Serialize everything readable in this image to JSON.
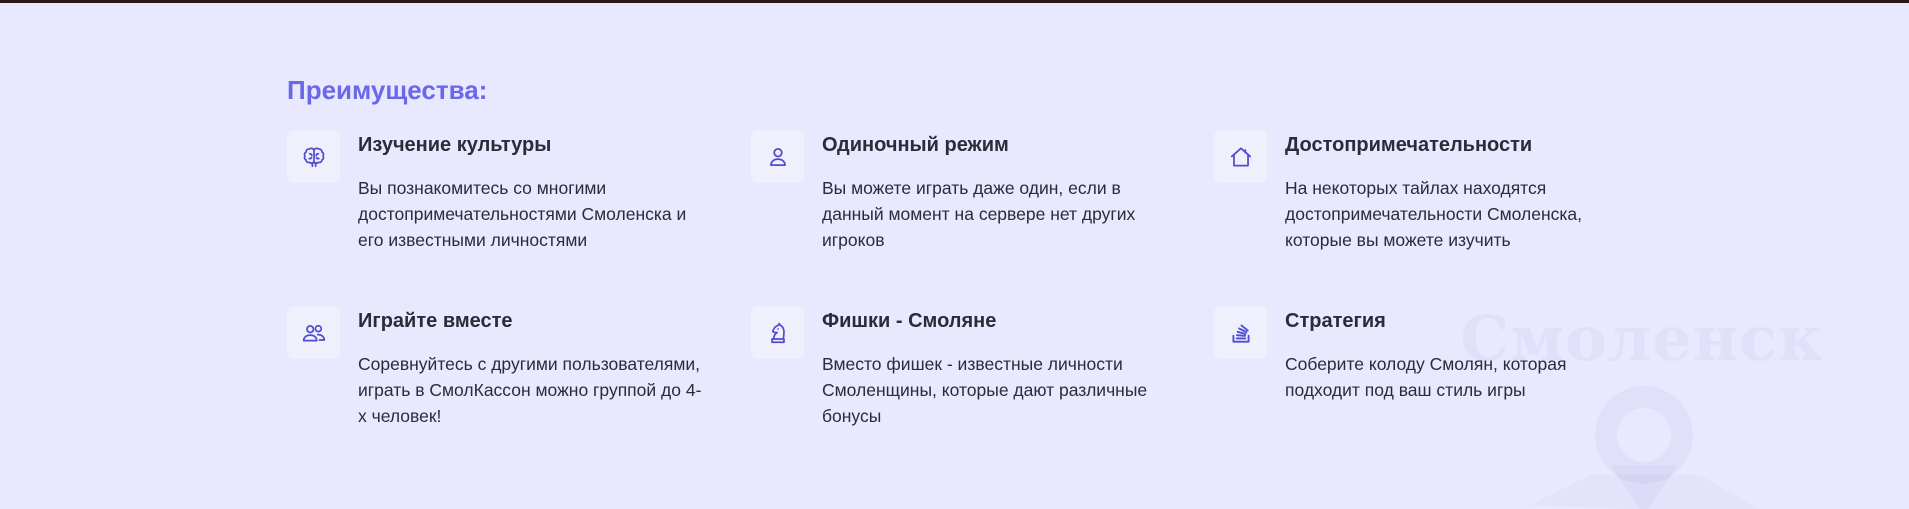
{
  "section": {
    "title": "Преимущества:"
  },
  "watermark": {
    "text": "Смоленск"
  },
  "colors": {
    "background": "#e8e8ff",
    "accent": "#6a68e8",
    "icon": "#4f4cd0",
    "text": "#2b2b3a"
  },
  "features": [
    {
      "icon": "brain-icon",
      "title": "Изучение культуры",
      "desc": "Вы познакомитесь со многими достопримечательностями Смоленска и его известными личностями"
    },
    {
      "icon": "user-icon",
      "title": "Одиночный режим",
      "desc": "Вы можете играть даже один, если в данный момент на сервере нет других игроков"
    },
    {
      "icon": "home-icon",
      "title": "Достопримечательности",
      "desc": "На некоторых тайлах находятся достопримечательности Смоленска, которые вы можете изучить"
    },
    {
      "icon": "users-icon",
      "title": "Играйте вместе",
      "desc": "Соревнуйтесь с другими пользователями, играть в СмолКассон можно группой до 4-х человек!"
    },
    {
      "icon": "chess-knight-icon",
      "title": "Фишки - Смоляне",
      "desc": "Вместо фишек - известные личности Смоленщины, которые дают различные бонусы"
    },
    {
      "icon": "stack-icon",
      "title": "Стратегия",
      "desc": "Соберите колоду Смолян, которая подходит под ваш стиль игры"
    }
  ]
}
